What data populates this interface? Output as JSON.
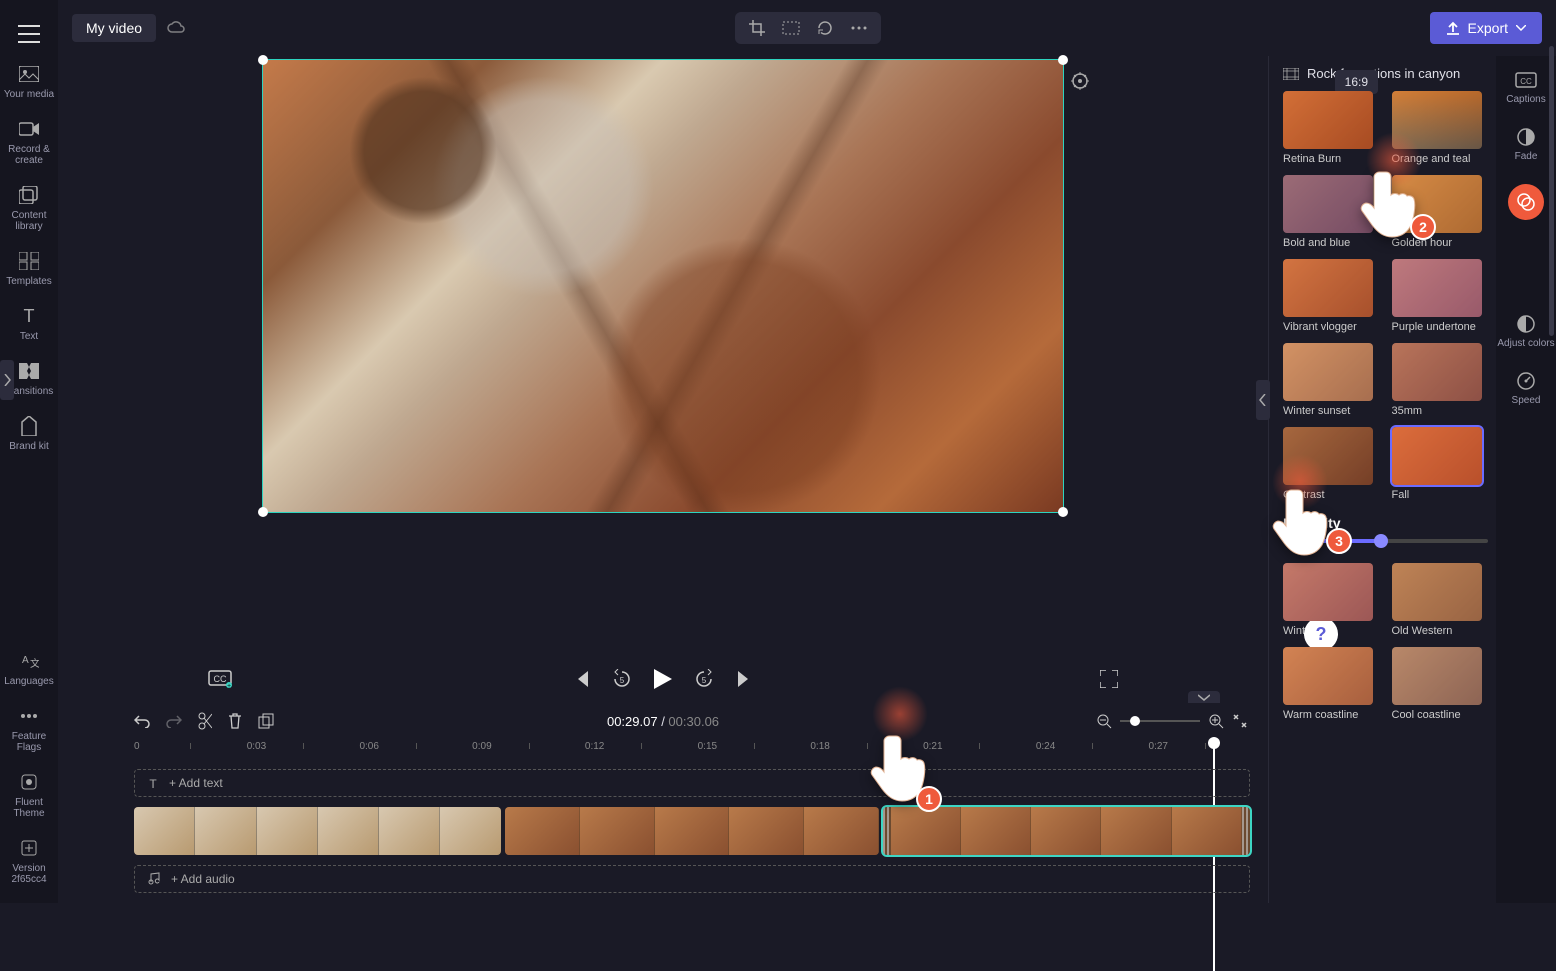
{
  "topbar": {
    "project_name": "My video",
    "export_label": "Export"
  },
  "left_nav": {
    "your_media": "Your media",
    "record_create": "Record & create",
    "content_library": "Content library",
    "templates": "Templates",
    "text": "Text",
    "transitions": "Transitions",
    "brand_kit": "Brand kit",
    "languages": "Languages",
    "feature_flags": "Feature Flags",
    "fluent_theme": "Fluent Theme",
    "version_label": "Version 2f65cc4"
  },
  "preview": {
    "aspect": "16:9"
  },
  "playback": {
    "current_time": "00:29.07",
    "separator": " / ",
    "total_time": "00:30.06"
  },
  "ruler": {
    "marks": [
      "0",
      "0:03",
      "0:06",
      "0:09",
      "0:12",
      "0:15",
      "0:18",
      "0:21",
      "0:24",
      "0:27"
    ]
  },
  "tracks": {
    "text_placeholder": "+ Add text",
    "audio_placeholder": "+ Add audio"
  },
  "right_panel": {
    "clip_name": "Rock formations in canyon",
    "filters": [
      {
        "key": "retina",
        "label": "Retina Burn",
        "tint": "t-retina"
      },
      {
        "key": "ot",
        "label": "Orange and teal",
        "tint": "t-ot"
      },
      {
        "key": "bb",
        "label": "Bold and blue",
        "tint": "t-bb"
      },
      {
        "key": "gh",
        "label": "Golden hour",
        "tint": "t-gh"
      },
      {
        "key": "vv",
        "label": "Vibrant vlogger",
        "tint": "t-vv"
      },
      {
        "key": "pu",
        "label": "Purple undertone",
        "tint": "t-pu"
      },
      {
        "key": "ws",
        "label": "Winter sunset",
        "tint": "t-ws"
      },
      {
        "key": "f35",
        "label": "35mm",
        "tint": "t-35"
      },
      {
        "key": "con",
        "label": "Contrast",
        "tint": "t-con"
      },
      {
        "key": "fall",
        "label": "Fall",
        "tint": "t-fall",
        "selected": true
      },
      {
        "key": "win",
        "label": "Winter",
        "tint": "t-win"
      },
      {
        "key": "ow",
        "label": "Old Western",
        "tint": "t-ow"
      },
      {
        "key": "wc",
        "label": "Warm coastline",
        "tint": "t-wc"
      },
      {
        "key": "cc",
        "label": "Cool coastline",
        "tint": "t-cc"
      }
    ],
    "intensity_label": "Intensity"
  },
  "far_right": {
    "captions": "Captions",
    "fade": "Fade",
    "filters": "Filters",
    "adjust": "Adjust colors",
    "speed": "Speed"
  },
  "annotations": {
    "step1": "1",
    "step2": "2",
    "step3": "3"
  }
}
